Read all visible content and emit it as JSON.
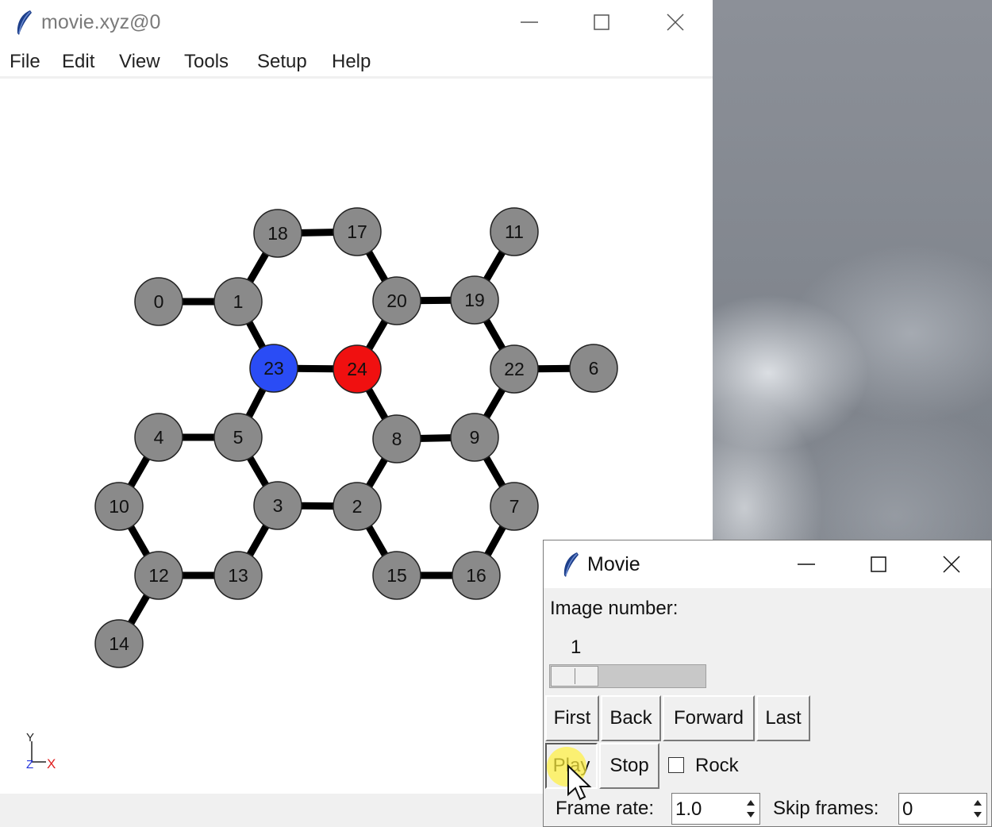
{
  "main_window": {
    "title": "movie.xyz@0",
    "menu": [
      "File",
      "Edit",
      "View",
      "Tools",
      "Setup",
      "Help"
    ]
  },
  "molecule": {
    "atoms": [
      {
        "label": "0",
        "color": "#8a8a8a"
      },
      {
        "label": "1",
        "color": "#8a8a8a"
      },
      {
        "label": "2",
        "color": "#8a8a8a"
      },
      {
        "label": "3",
        "color": "#8a8a8a"
      },
      {
        "label": "4",
        "color": "#8a8a8a"
      },
      {
        "label": "5",
        "color": "#8a8a8a"
      },
      {
        "label": "6",
        "color": "#8a8a8a"
      },
      {
        "label": "7",
        "color": "#8a8a8a"
      },
      {
        "label": "8",
        "color": "#8a8a8a"
      },
      {
        "label": "9",
        "color": "#8a8a8a"
      },
      {
        "label": "10",
        "color": "#8a8a8a"
      },
      {
        "label": "11",
        "color": "#8a8a8a"
      },
      {
        "label": "12",
        "color": "#8a8a8a"
      },
      {
        "label": "13",
        "color": "#8a8a8a"
      },
      {
        "label": "14",
        "color": "#8a8a8a"
      },
      {
        "label": "15",
        "color": "#8a8a8a"
      },
      {
        "label": "16",
        "color": "#8a8a8a"
      },
      {
        "label": "17",
        "color": "#8a8a8a"
      },
      {
        "label": "18",
        "color": "#8a8a8a"
      },
      {
        "label": "19",
        "color": "#8a8a8a"
      },
      {
        "label": "20",
        "color": "#8a8a8a"
      },
      {
        "label": "22",
        "color": "#8a8a8a"
      },
      {
        "label": "23",
        "color": "#2a4cf5"
      },
      {
        "label": "24",
        "color": "#f01010"
      }
    ],
    "axes": {
      "y": "Y",
      "x": "X",
      "z": "Z"
    }
  },
  "movie_dialog": {
    "title": "Movie",
    "image_number_label": "Image number:",
    "image_number_value": "1",
    "buttons": {
      "first": "First",
      "back": "Back",
      "forward": "Forward",
      "last": "Last",
      "play": "Play",
      "stop": "Stop"
    },
    "rock_label": "Rock",
    "rock_checked": false,
    "frame_rate_label": "Frame rate:",
    "frame_rate_value": "1.0",
    "skip_frames_label": "Skip frames:",
    "skip_frames_value": "0"
  }
}
